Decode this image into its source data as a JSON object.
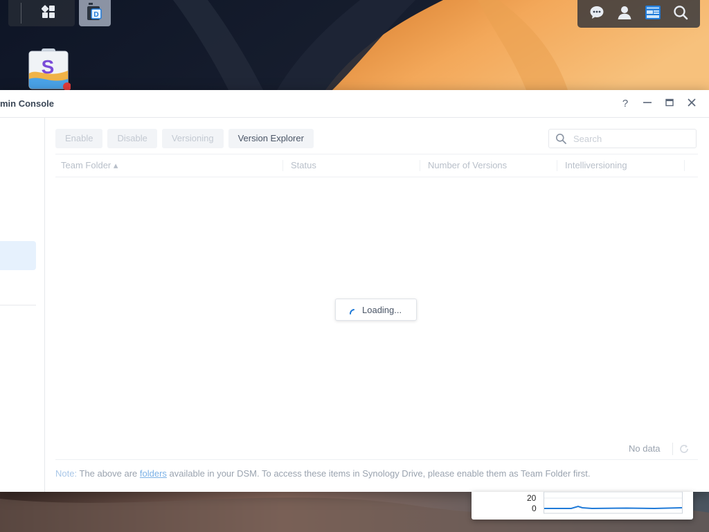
{
  "window": {
    "title": "min Console",
    "help": "?",
    "minimize": "—",
    "close": "✕"
  },
  "toolbar": {
    "enable": "Enable",
    "disable": "Disable",
    "versioning": "Versioning",
    "version_explorer": "Version Explorer"
  },
  "search": {
    "placeholder": "Search"
  },
  "grid": {
    "columns": [
      "Team Folder ▴",
      "Status",
      "Number of Versions",
      "Intelliversioning"
    ]
  },
  "loading": {
    "text": "Loading..."
  },
  "footer": {
    "no_data": "No data",
    "note_label": "Note:",
    "note_before": " The above are ",
    "note_link": "folders",
    "note_after": " available in your DSM. To access these items in Synology Drive, please enable them as Team Folder first."
  },
  "widget": {
    "y_top": "20",
    "y_bottom": "0"
  },
  "icons": {
    "main_menu": "grid-icon",
    "task_app": "synology-drive-admin-icon",
    "messages": "chat-icon",
    "user": "user-icon",
    "widgets": "widgets-icon",
    "search": "search-icon",
    "desktop_app": "package-center-icon"
  },
  "colors": {
    "accent": "#1f7ad8",
    "active_item": "#e6f1fd",
    "note_link": "#7bb1e6"
  }
}
